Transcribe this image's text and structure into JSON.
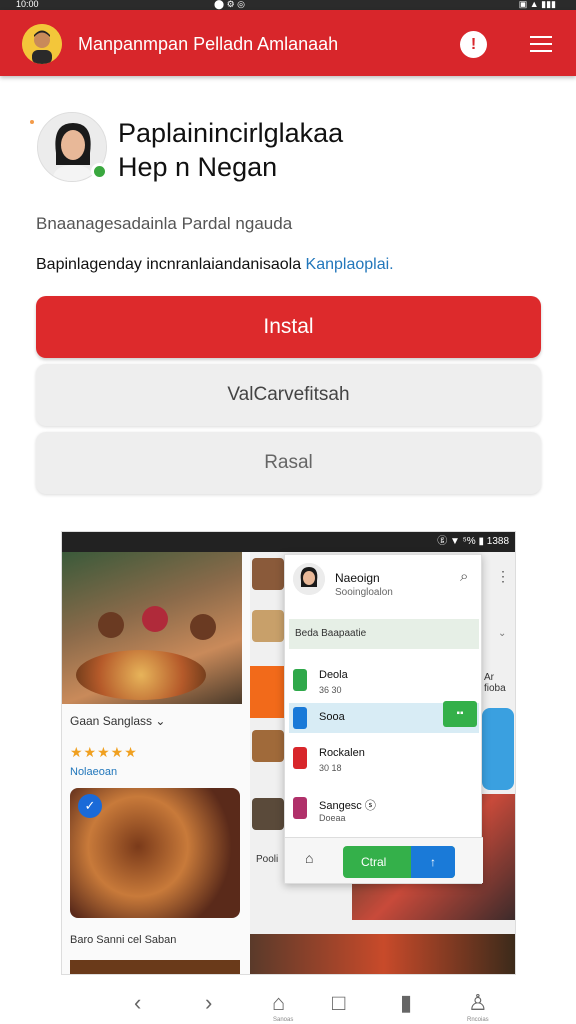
{
  "status_bar": {
    "left": "10:00",
    "mid": "⬤ ⚙ ◎",
    "right": "▣ ▲ ▮▮▮"
  },
  "app_bar": {
    "title": "Manpanmpan Pelladn Amlanaah",
    "alarm_glyph": "!",
    "menu_icon": "hamburger-icon"
  },
  "profile": {
    "name_line1": "Paplainincirlglakaa",
    "name_line2": "Hep n Negan",
    "online": true
  },
  "tagline": "Bnaanagesadainla Pardal ngauda",
  "description": {
    "text": "Bapinlagenday incnranlaiandanisaola",
    "link": "Kanplaoplai."
  },
  "buttons": {
    "install": "Instal",
    "second": "ValCarvefitsah",
    "third": "Rasal"
  },
  "preview": {
    "status_text": "ⓖ ▼ ⁵% ▮ 1388",
    "rating_label": "Gaan Sanglass ⌄",
    "stars": "★★★★★",
    "rating_sub": "Nolaeoan",
    "bottom_label": "Baro Sanni cel Saban",
    "card": {
      "name": "Naeoign",
      "sub": "Sooingloalon",
      "select": "Beda Baapaatie",
      "items": [
        {
          "label": "Deola",
          "sub": "36 30",
          "color": "#2fa84a"
        },
        {
          "label": "Sooa",
          "sub": "",
          "color": "#1a7ad8"
        },
        {
          "label": "Rockalen",
          "sub": "30 18",
          "color": "#d8262b"
        },
        {
          "label": "Sangesc ⓢ",
          "sub": "Doeaa",
          "color": "#b0306a"
        }
      ],
      "green_chip": "▪▪",
      "cta": "Ctral",
      "cta_arrow": "↑"
    },
    "side_text": "Ar fioba",
    "side_text2": "Pooli"
  },
  "bottom_nav": {
    "back": "‹",
    "forward": "›",
    "home_label": "Sanoas",
    "tabs": "□",
    "book": "▮",
    "profile_label": "Rncoias"
  }
}
